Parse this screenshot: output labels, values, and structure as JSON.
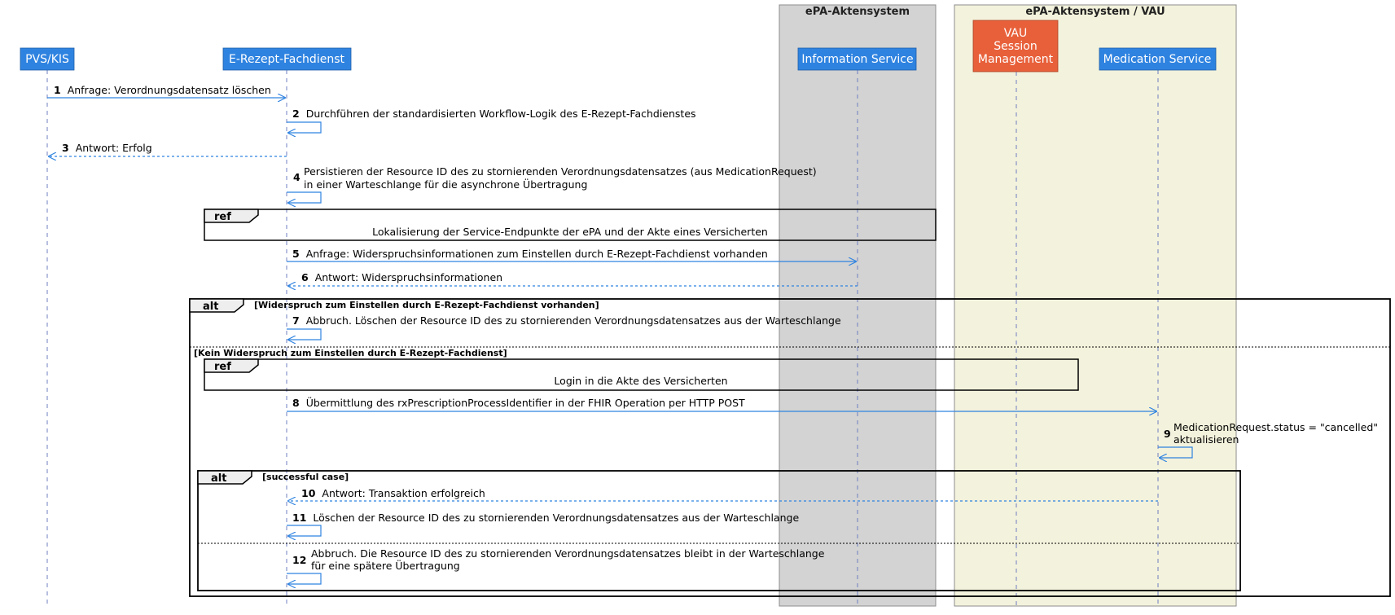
{
  "participants": [
    {
      "id": "pvs",
      "label": "PVS/KIS",
      "color": "#2f83e0"
    },
    {
      "id": "erp",
      "label": "E-Rezept-Fachdienst",
      "color": "#2f83e0"
    },
    {
      "id": "info",
      "label": "Information Service",
      "color": "#2f83e0"
    },
    {
      "id": "vau",
      "lines": [
        "VAU",
        "Session",
        "Management"
      ],
      "color": "#e8603a"
    },
    {
      "id": "med",
      "label": "Medication Service",
      "color": "#2f83e0"
    }
  ],
  "boxes": [
    {
      "title": "ePA-Aktensystem",
      "color": "#d3d3d3"
    },
    {
      "title": "ePA-Aktensystem / VAU",
      "color": "#f3f2dc"
    }
  ],
  "messages": [
    {
      "num": "1",
      "lines": [
        "Anfrage: Verordnungsdatensatz löschen"
      ],
      "from": "pvs",
      "to": "erp",
      "dashed": false
    },
    {
      "num": "2",
      "lines": [
        "Durchführen der standardisierten Workflow-Logik des E-Rezept-Fachdienstes"
      ],
      "from": "erp",
      "to": "erp",
      "dashed": false
    },
    {
      "num": "3",
      "lines": [
        "Antwort: Erfolg"
      ],
      "from": "erp",
      "to": "pvs",
      "dashed": true
    },
    {
      "num": "4",
      "lines": [
        "Persistieren der Resource ID des zu stornierenden Verordnungsdatensatzes (aus MedicationRequest)",
        "in einer Warteschlange für die asynchrone Übertragung"
      ],
      "from": "erp",
      "to": "erp",
      "dashed": false
    },
    {
      "num": "5",
      "lines": [
        "Anfrage: Widerspruchsinformationen zum Einstellen durch E-Rezept-Fachdienst vorhanden"
      ],
      "from": "erp",
      "to": "info",
      "dashed": false
    },
    {
      "num": "6",
      "lines": [
        "Antwort: Widerspruchsinformationen"
      ],
      "from": "info",
      "to": "erp",
      "dashed": true
    },
    {
      "num": "7",
      "lines": [
        "Abbruch. Löschen der Resource ID des zu stornierenden Verordnungsdatensatzes aus der Warteschlange"
      ],
      "from": "erp",
      "to": "erp",
      "dashed": false
    },
    {
      "num": "8",
      "lines": [
        "Übermittlung des rxPrescriptionProcessIdentifier in der FHIR Operation per HTTP POST"
      ],
      "from": "erp",
      "to": "med",
      "dashed": false
    },
    {
      "num": "9",
      "lines": [
        "MedicationRequest.status = \"cancelled\"",
        "aktualisieren"
      ],
      "from": "med",
      "to": "med",
      "dashed": false
    },
    {
      "num": "10",
      "lines": [
        "Antwort: Transaktion erfolgreich"
      ],
      "from": "med",
      "to": "erp",
      "dashed": true
    },
    {
      "num": "11",
      "lines": [
        "Löschen der Resource ID des zu stornierenden Verordnungsdatensatzes aus der Warteschlange"
      ],
      "from": "erp",
      "to": "erp",
      "dashed": false
    },
    {
      "num": "12",
      "lines": [
        "Abbruch. Die Resource ID des zu stornierenden Verordnungsdatensatzes bleibt in der Warteschlange",
        "für eine spätere Übertragung"
      ],
      "from": "erp",
      "to": "erp",
      "dashed": false
    }
  ],
  "refs": [
    {
      "tag": "ref",
      "text": "Lokalisierung der Service-Endpunkte der ePA und der Akte eines Versicherten"
    },
    {
      "tag": "ref",
      "text": "Login in die Akte des Versicherten"
    }
  ],
  "fragments": [
    {
      "tag": "alt",
      "guard": "[Widerspruch zum Einstellen durch E-Rezept-Fachdienst vorhanden]",
      "else_guard": "[Kein Widerspruch zum Einstellen durch E-Rezept-Fachdienst]"
    },
    {
      "tag": "alt",
      "guard": "[successful case]",
      "else_guard": ""
    }
  ],
  "colors": {
    "arrow": "#2f83e0",
    "lifeline": "#6f7fbf",
    "frame": "#000000"
  }
}
